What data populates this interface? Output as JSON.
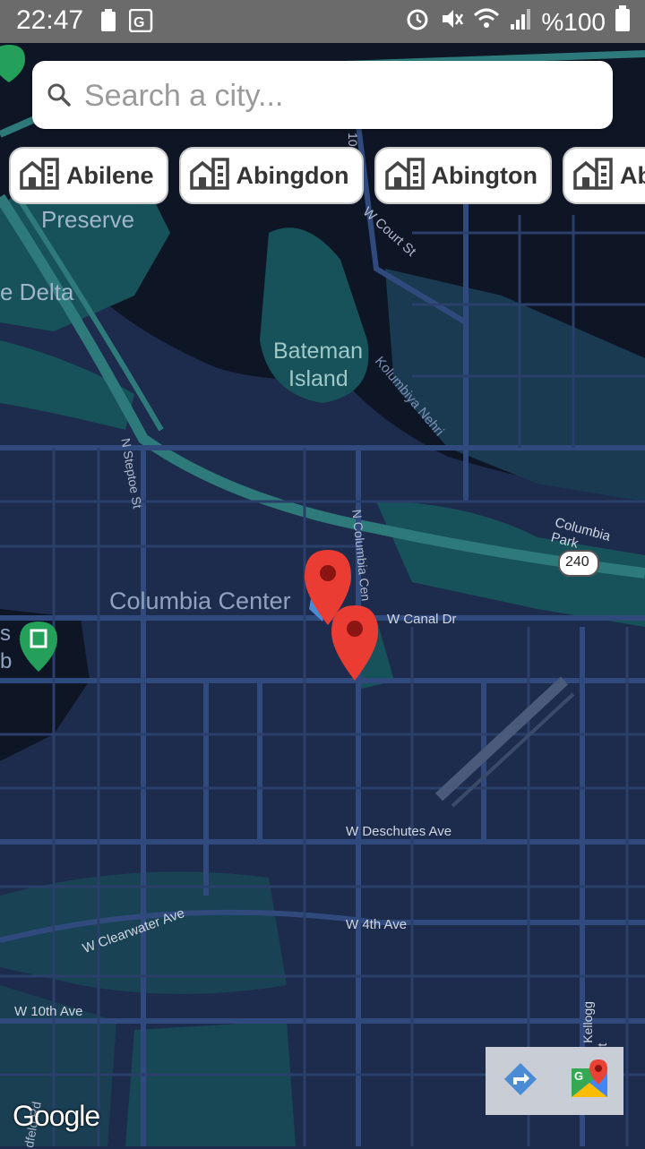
{
  "status_bar": {
    "time": "22:47",
    "battery_text": "%100"
  },
  "search": {
    "placeholder": "Search a city..."
  },
  "chips": [
    "Abilene",
    "Abingdon",
    "Abington",
    "Absecon"
  ],
  "map_labels": {
    "preserve": "Preserve",
    "delta": "e Delta",
    "island_line1": "Bateman",
    "island_line2": "Island",
    "river": "Kolumbiya Nehri",
    "court_st": "W Court St",
    "steptoe": "N Steptoe St",
    "columbia_center_st": "N Columbia Cen",
    "columbia_center": "Columbia Center",
    "canal": "W Canal Dr",
    "columbia_park": "Columbia Park",
    "route": "240",
    "deschutes": "W Deschutes Ave",
    "clearwater": "W Clearwater Ave",
    "fourth": "W 4th Ave",
    "tenth": "W 10th Ave",
    "kellogg": "S Kellogg St",
    "rd": "dfeld Rd",
    "s_fragment": "s",
    "b_fragment": "b",
    "st_10": "10"
  },
  "attribution": "Google",
  "colors": {
    "map_bg": "#1d2c4d",
    "water": "#0e1626",
    "teal": "#17525a",
    "road": "#304a7d",
    "marker": "#ea3c33"
  }
}
